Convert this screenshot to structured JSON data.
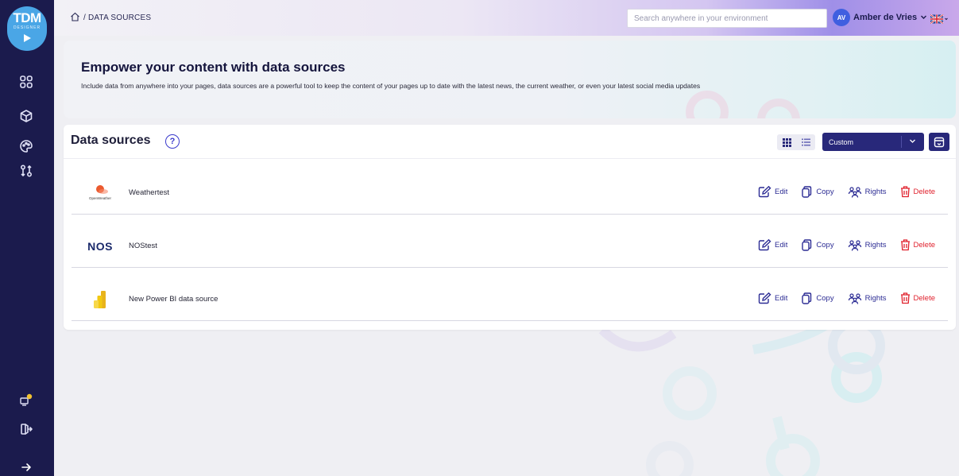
{
  "sidebar": {
    "logo": {
      "line1": "TDM",
      "line2": "DESIGNER"
    },
    "icons": [
      "dashboard-icon",
      "cube-icon",
      "palette-icon",
      "data-sources-icon",
      "notification-screen-icon",
      "logout-icon",
      "expand-arrow-icon"
    ]
  },
  "header": {
    "breadcrumb": "/ DATA SOURCES",
    "search_placeholder": "Search anywhere in your environment",
    "user": {
      "initials": "AV",
      "name": "Amber de Vries"
    },
    "language_flag": "uk-flag-icon"
  },
  "banner": {
    "title": "Empower your content with data sources",
    "description": "Include data from anywhere into your pages, data sources are a powerful tool to keep the content of your pages up to date with the latest news, the current weather, or even your latest social media updates"
  },
  "card": {
    "title": "Data sources",
    "help": "?",
    "filter": {
      "selected": "Custom"
    }
  },
  "actions": {
    "edit": "Edit",
    "copy": "Copy",
    "rights": "Rights",
    "delete": "Delete"
  },
  "rows": [
    {
      "name": "Weathertest",
      "logo_text": "OpenWeather",
      "logo_icon": "openweather-logo"
    },
    {
      "name": "NOStest",
      "logo_text": "NOS",
      "logo_icon": "nos-logo"
    },
    {
      "name": "New Power BI data source",
      "logo_text": "",
      "logo_icon": "power-bi-logo"
    }
  ],
  "colors": {
    "sidebar": "#1b1b4d",
    "primary": "#28287a",
    "action": "#2c2c94",
    "danger": "#e0202c",
    "logo": "#4aa6e6"
  }
}
